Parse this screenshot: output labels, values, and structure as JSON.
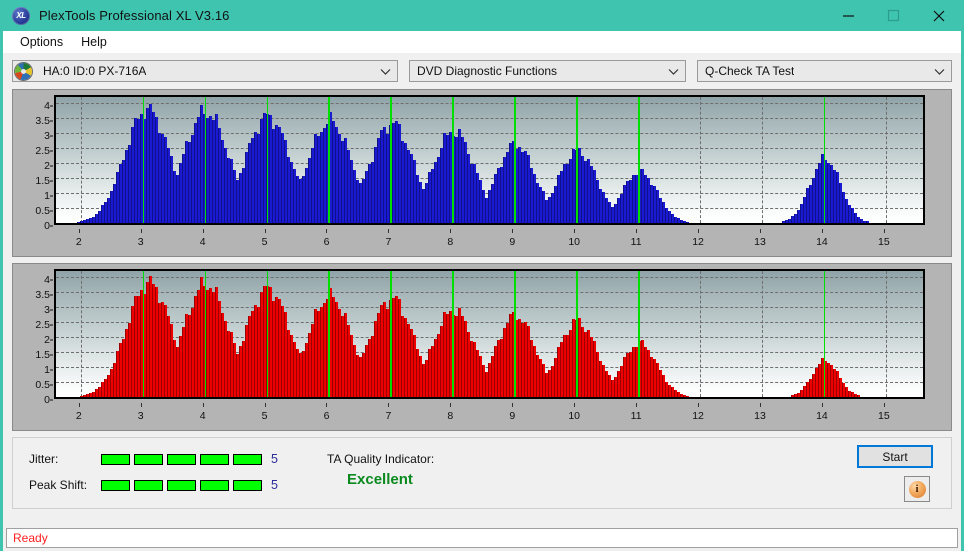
{
  "window": {
    "title": "PlexTools Professional XL V3.16",
    "app_icon": "xl-disc-icon",
    "minimize": "minimize-icon",
    "maximize": "maximize-icon",
    "close": "close-icon",
    "titlebar_color": "#3fc4b0"
  },
  "menu": {
    "items": [
      {
        "label": "Options"
      },
      {
        "label": "Help"
      }
    ]
  },
  "toolbar": {
    "drive_select": {
      "value": "HA:0 ID:0  PX-716A",
      "icon": "optical-disc-icon"
    },
    "function_select": {
      "value": "DVD Diagnostic Functions"
    },
    "test_select": {
      "value": "Q-Check TA Test"
    }
  },
  "charts": {
    "y_ticks": [
      "4",
      "3.5",
      "3",
      "2.5",
      "2",
      "1.5",
      "1",
      "0.5",
      "0"
    ],
    "x_ticks": [
      "2",
      "3",
      "4",
      "5",
      "6",
      "7",
      "8",
      "9",
      "10",
      "11",
      "12",
      "13",
      "14",
      "15"
    ]
  },
  "chart_data": [
    {
      "type": "bar",
      "name": "jitter-chart",
      "title": "",
      "color": "#1a1ad2",
      "xlabel": "",
      "ylabel": "",
      "ylim": [
        0,
        4.2
      ],
      "xlim": [
        1.6,
        15.6
      ],
      "grid": true,
      "marker_color": "#00e000",
      "markers": [
        3,
        4,
        5,
        6,
        7,
        8,
        9,
        10,
        11,
        14
      ],
      "peaks": [
        {
          "center": 3.05,
          "height": 3.78,
          "width": 0.52
        },
        {
          "center": 4.0,
          "height": 3.7,
          "width": 0.52
        },
        {
          "center": 5.0,
          "height": 3.55,
          "width": 0.52
        },
        {
          "center": 6.0,
          "height": 3.4,
          "width": 0.5
        },
        {
          "center": 7.0,
          "height": 3.32,
          "width": 0.5
        },
        {
          "center": 8.0,
          "height": 3.05,
          "width": 0.48
        },
        {
          "center": 9.0,
          "height": 2.62,
          "width": 0.45
        },
        {
          "center": 10.0,
          "height": 2.4,
          "width": 0.45
        },
        {
          "center": 11.0,
          "height": 1.72,
          "width": 0.4
        },
        {
          "center": 14.0,
          "height": 2.15,
          "width": 0.35
        }
      ]
    },
    {
      "type": "bar",
      "name": "peak-shift-chart",
      "title": "",
      "color": "#ee0000",
      "xlabel": "",
      "ylabel": "",
      "ylim": [
        0,
        4.2
      ],
      "xlim": [
        1.6,
        15.6
      ],
      "grid": true,
      "marker_color": "#00e000",
      "markers": [
        3,
        4,
        5,
        6,
        7,
        8,
        9,
        10,
        11,
        14
      ],
      "peaks": [
        {
          "center": 3.08,
          "height": 3.8,
          "width": 0.52
        },
        {
          "center": 4.0,
          "height": 3.76,
          "width": 0.52
        },
        {
          "center": 5.0,
          "height": 3.6,
          "width": 0.52
        },
        {
          "center": 6.0,
          "height": 3.35,
          "width": 0.5
        },
        {
          "center": 7.0,
          "height": 3.28,
          "width": 0.5
        },
        {
          "center": 8.0,
          "height": 2.88,
          "width": 0.48
        },
        {
          "center": 9.0,
          "height": 2.72,
          "width": 0.45
        },
        {
          "center": 10.0,
          "height": 2.52,
          "width": 0.45
        },
        {
          "center": 11.0,
          "height": 1.8,
          "width": 0.4
        },
        {
          "center": 14.0,
          "height": 1.22,
          "width": 0.3
        }
      ]
    }
  ],
  "metrics": {
    "jitter": {
      "label": "Jitter:",
      "value": "5",
      "led_count": 5,
      "led_color": "#00ff00"
    },
    "peak_shift": {
      "label": "Peak Shift:",
      "value": "5",
      "led_count": 5,
      "led_color": "#00ff00"
    }
  },
  "quality": {
    "label": "TA Quality Indicator:",
    "value": "Excellent",
    "color": "#0a8a1e"
  },
  "actions": {
    "start_label": "Start",
    "info_icon": "info-icon",
    "info_glyph": "i"
  },
  "status": {
    "text": "Ready",
    "color": "#ff2020"
  }
}
